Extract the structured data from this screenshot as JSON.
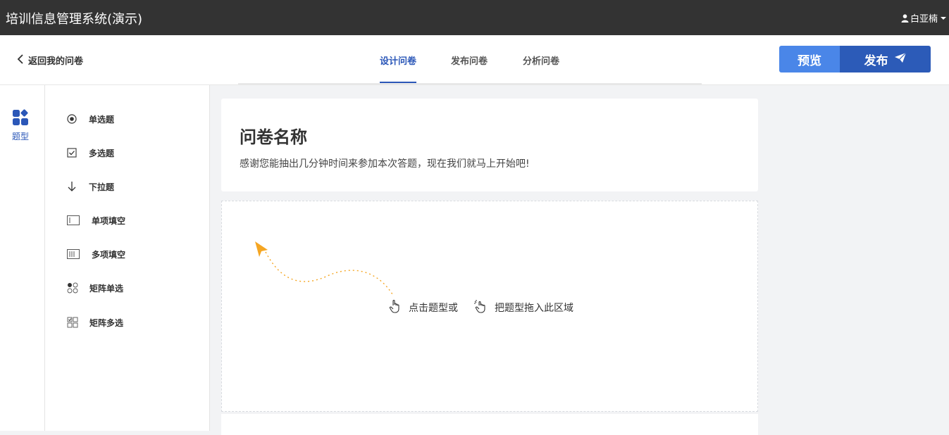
{
  "app": {
    "title": "培训信息管理系统(演示)"
  },
  "user": {
    "name": "白亚楠"
  },
  "nav": {
    "back_label": "返回我的问卷",
    "tabs": [
      {
        "label": "设计问卷",
        "active": true
      },
      {
        "label": "发布问卷",
        "active": false
      },
      {
        "label": "分析问卷",
        "active": false
      }
    ],
    "preview_label": "预览",
    "publish_label": "发布"
  },
  "sidebar": {
    "question_types_label": "题型"
  },
  "question_types": [
    {
      "label": "单选题",
      "icon": "radio-icon"
    },
    {
      "label": "多选题",
      "icon": "checkbox-icon"
    },
    {
      "label": "下拉题",
      "icon": "arrow-down-icon"
    },
    {
      "label": "单项填空",
      "icon": "single-input-icon"
    },
    {
      "label": "多项填空",
      "icon": "multi-input-icon"
    },
    {
      "label": "矩阵单选",
      "icon": "matrix-radio-icon"
    },
    {
      "label": "矩阵多选",
      "icon": "matrix-checkbox-icon"
    }
  ],
  "survey": {
    "title": "问卷名称",
    "description": "感谢您能抽出几分钟时间来参加本次答题，现在我们就马上开始吧!"
  },
  "dropzone": {
    "hint_click": "点击题型或",
    "hint_drag": "把题型拖入此区域"
  },
  "colors": {
    "topbar": "#333333",
    "accent": "#2b57b8",
    "preview_button": "#4a86e8",
    "publish_button": "#2c5bb8",
    "hint_arrow": "#f5a623"
  }
}
